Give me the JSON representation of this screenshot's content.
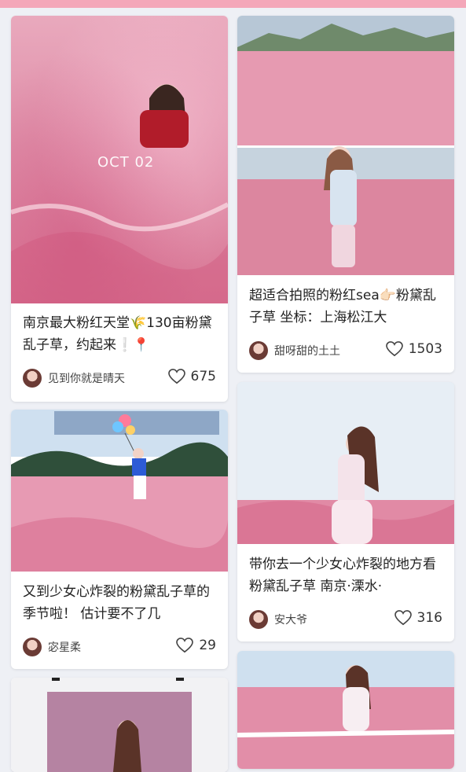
{
  "feed": {
    "cards": [
      {
        "title": "南京最大粉红天堂🌾130亩粉黛乱子草，约起来❕📍",
        "user": "见到你就是晴天",
        "likes": "675",
        "overlay": "OCT 02"
      },
      {
        "title": "超适合拍照的粉红sea👉🏻粉黛乱子草 坐标：上海松江大",
        "user": "甜呀甜的土土",
        "likes": "1503"
      },
      {
        "title": "又到少女心炸裂的粉黛乱子草的季节啦！ 估计要不了几",
        "user": "宓星柔",
        "likes": "29"
      },
      {
        "title": "带你去一个少女心炸裂的地方看粉黛乱子草 南京·溧水·",
        "user": "安大爷",
        "likes": "316"
      },
      {},
      {}
    ]
  },
  "colors": {
    "accent": "#f4a7b9",
    "text": "#222222",
    "muted": "#444444"
  },
  "icons": {
    "like": "heart-outline-icon"
  }
}
